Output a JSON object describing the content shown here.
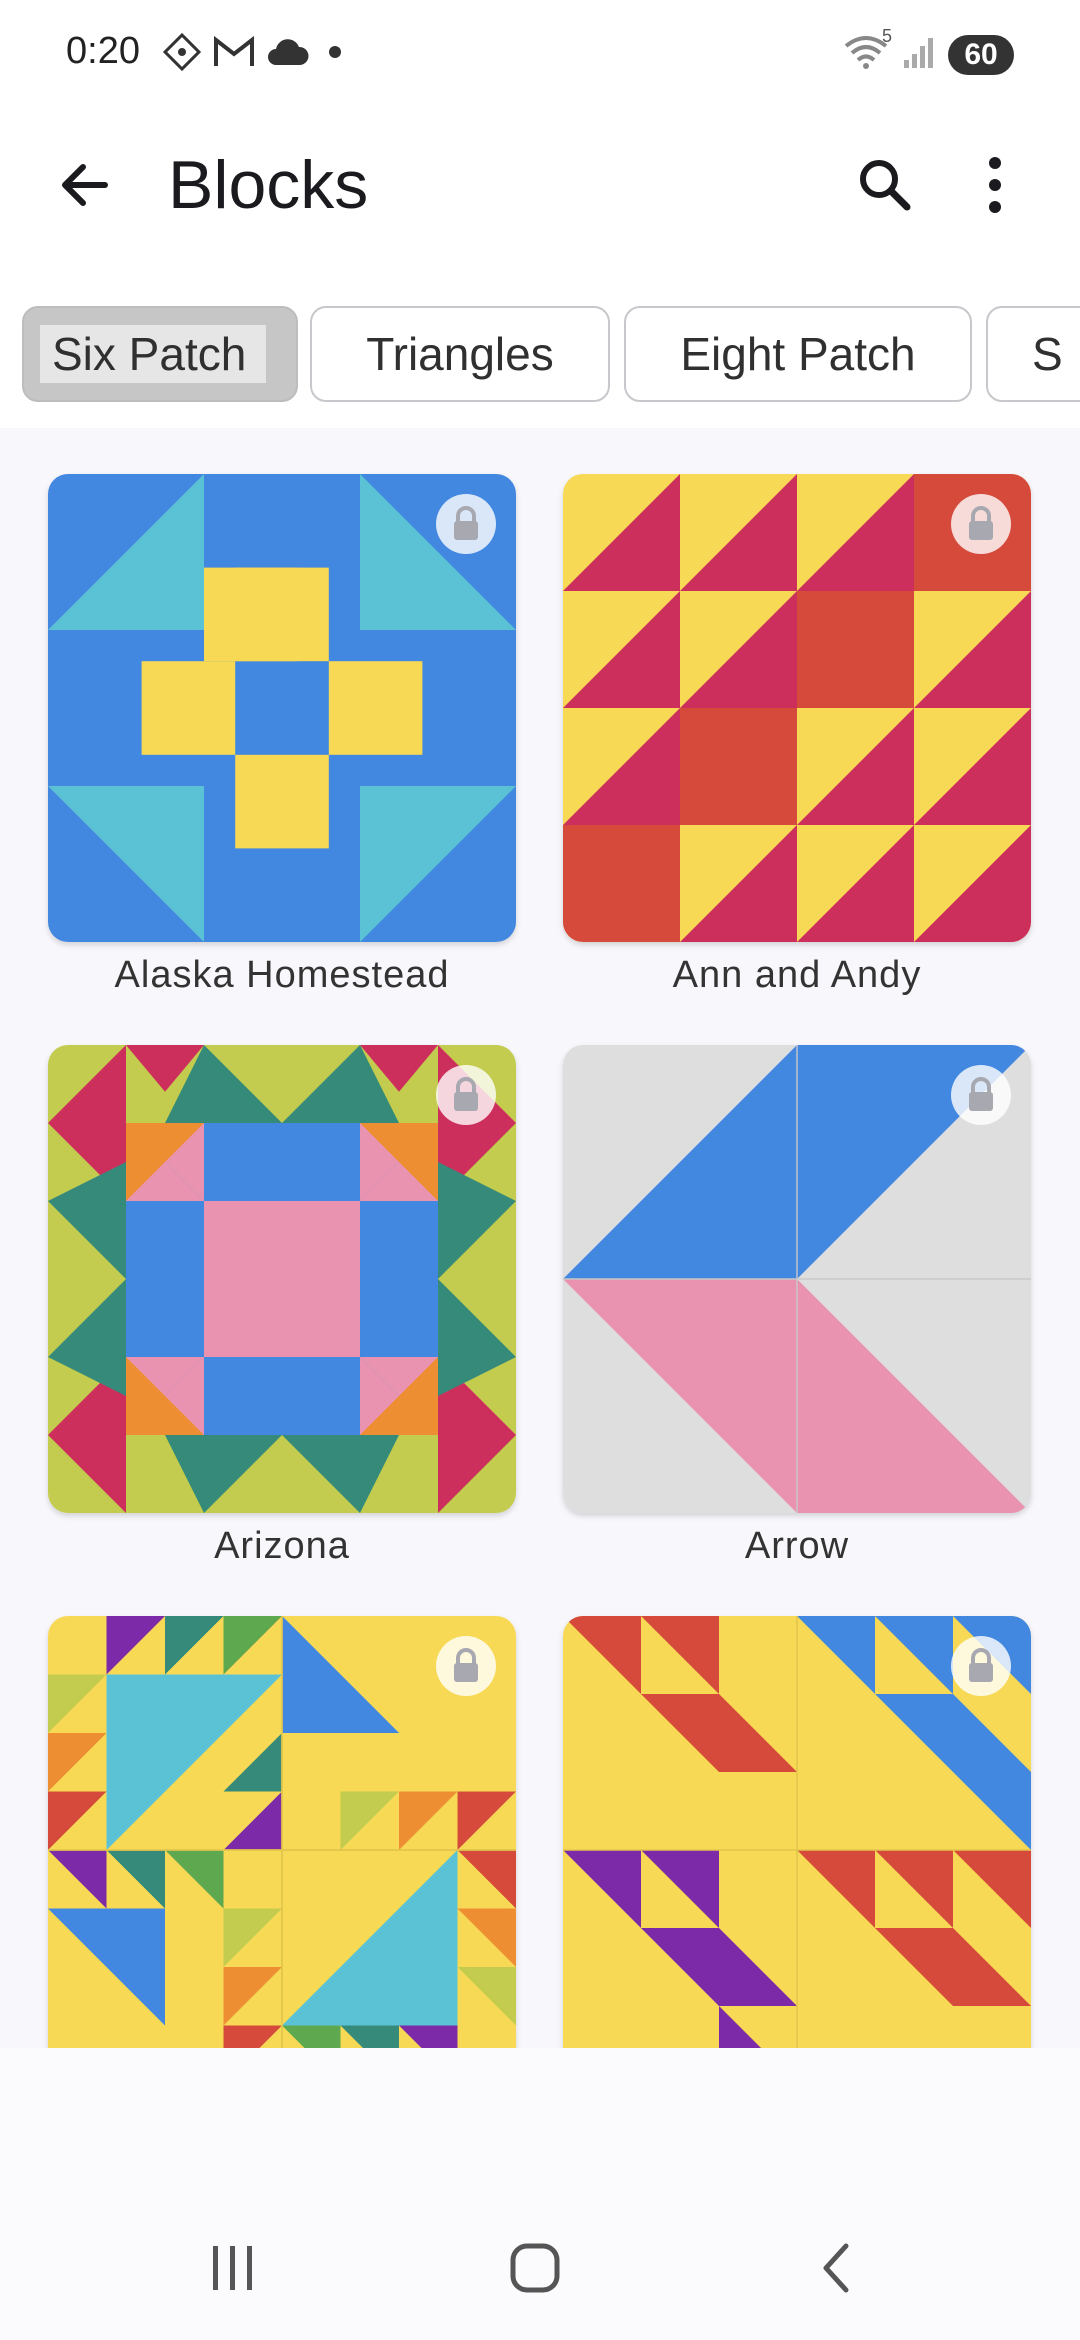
{
  "status_bar": {
    "time": "0:20",
    "left_icons": [
      "grid-diamond-icon",
      "gmail-icon",
      "cloud-icon",
      "dot-icon"
    ],
    "wifi_label": "5",
    "battery": "60"
  },
  "app_bar": {
    "title": "Blocks",
    "back_icon": "arrow-left-icon",
    "search_icon": "search-icon",
    "more_icon": "more-vertical-icon"
  },
  "chips": [
    {
      "label": "Six Patch",
      "selected": true
    },
    {
      "label": "Triangles",
      "selected": false
    },
    {
      "label": "Eight Patch",
      "selected": false
    },
    {
      "label": "S",
      "selected": false
    }
  ],
  "blocks": [
    {
      "name": "Alaska Homestead",
      "locked": true
    },
    {
      "name": "Ann and Andy",
      "locked": true
    },
    {
      "name": "Arizona",
      "locked": true
    },
    {
      "name": "Arrow",
      "locked": true
    },
    {
      "name": "",
      "locked": true
    },
    {
      "name": "",
      "locked": true
    }
  ],
  "nav_bar": {
    "recents_icon": "recents-icon",
    "home_icon": "home-icon",
    "back_icon": "nav-back-icon"
  },
  "colors": {
    "blue": "#4287e0",
    "cyan": "#5bc2d6",
    "yellow": "#f7d955",
    "crimson": "#cd2f5d",
    "red": "#d64a3c",
    "olive": "#c3cc4e",
    "teal": "#358a79",
    "pink": "#e993b0",
    "orange": "#ee8e33",
    "gray": "#dedede",
    "purple": "#7c2aa8",
    "green": "#5ea850"
  }
}
